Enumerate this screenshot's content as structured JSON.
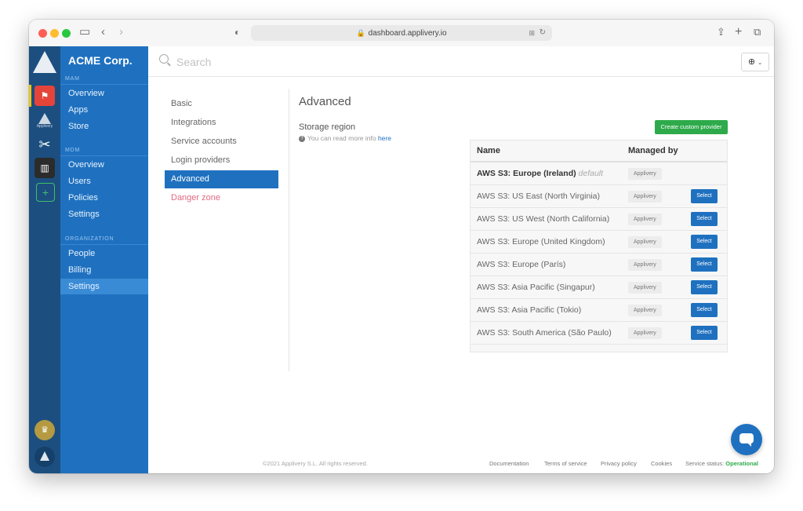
{
  "browser": {
    "url": "dashboard.applivery.io",
    "colors": {
      "close": "#ff5f57",
      "minimize": "#febc2e",
      "maximize": "#28c840"
    }
  },
  "rail": {
    "items": [
      {
        "name": "app-icon-red"
      },
      {
        "name": "applivery-app-icon",
        "label": "Applivery"
      },
      {
        "name": "tools-icon"
      },
      {
        "name": "city-app-icon"
      },
      {
        "name": "add-icon"
      }
    ]
  },
  "sidebar": {
    "brand": "ACME Corp.",
    "sections": [
      {
        "label": "MAM",
        "items": [
          "Overview",
          "Apps",
          "Store"
        ]
      },
      {
        "label": "MDM",
        "items": [
          "Overview",
          "Users",
          "Policies",
          "Settings"
        ]
      },
      {
        "label": "ORGANIZATION",
        "items": [
          "People",
          "Billing",
          "Settings"
        ]
      }
    ],
    "active": "Settings"
  },
  "search": {
    "placeholder": "Search"
  },
  "settings_nav": {
    "items": [
      "Basic",
      "Integrations",
      "Service accounts",
      "Login providers",
      "Advanced",
      "Danger zone"
    ],
    "active": "Advanced"
  },
  "content": {
    "title": "Advanced",
    "subtitle": "Storage region",
    "help_text": "You can read more info",
    "help_link": "here",
    "create_button": "Create custom provider",
    "table": {
      "headers": [
        "Name",
        "Managed by"
      ],
      "default_tag": "default",
      "rows": [
        {
          "name": "AWS S3: Europe (Ireland)",
          "managed_by": "Applivery",
          "is_default": true,
          "action": ""
        },
        {
          "name": "AWS S3: US East (North Virginia)",
          "managed_by": "Applivery",
          "action": "Select"
        },
        {
          "name": "AWS S3: US West (North California)",
          "managed_by": "Applivery",
          "action": "Select"
        },
        {
          "name": "AWS S3: Europe (United Kingdom)",
          "managed_by": "Applivery",
          "action": "Select"
        },
        {
          "name": "AWS S3: Europe (París)",
          "managed_by": "Applivery",
          "action": "Select"
        },
        {
          "name": "AWS S3: Asia Pacific (Singapur)",
          "managed_by": "Applivery",
          "action": "Select"
        },
        {
          "name": "AWS S3: Asia Pacific (Tokio)",
          "managed_by": "Applivery",
          "action": "Select"
        },
        {
          "name": "AWS S3: South America (São Paulo)",
          "managed_by": "Applivery",
          "action": "Select"
        }
      ]
    }
  },
  "footer": {
    "copyright": "©2021 Applivery S.L. All rights reserved.",
    "links": [
      "Documentation",
      "Terms of service",
      "Privacy policy",
      "Cookies"
    ],
    "status_label": "Service status:",
    "status_value": "Operational"
  },
  "colors": {
    "brand_blue": "#1f71c0",
    "success_green": "#2eaa4a",
    "danger_pink": "#e06b82"
  }
}
